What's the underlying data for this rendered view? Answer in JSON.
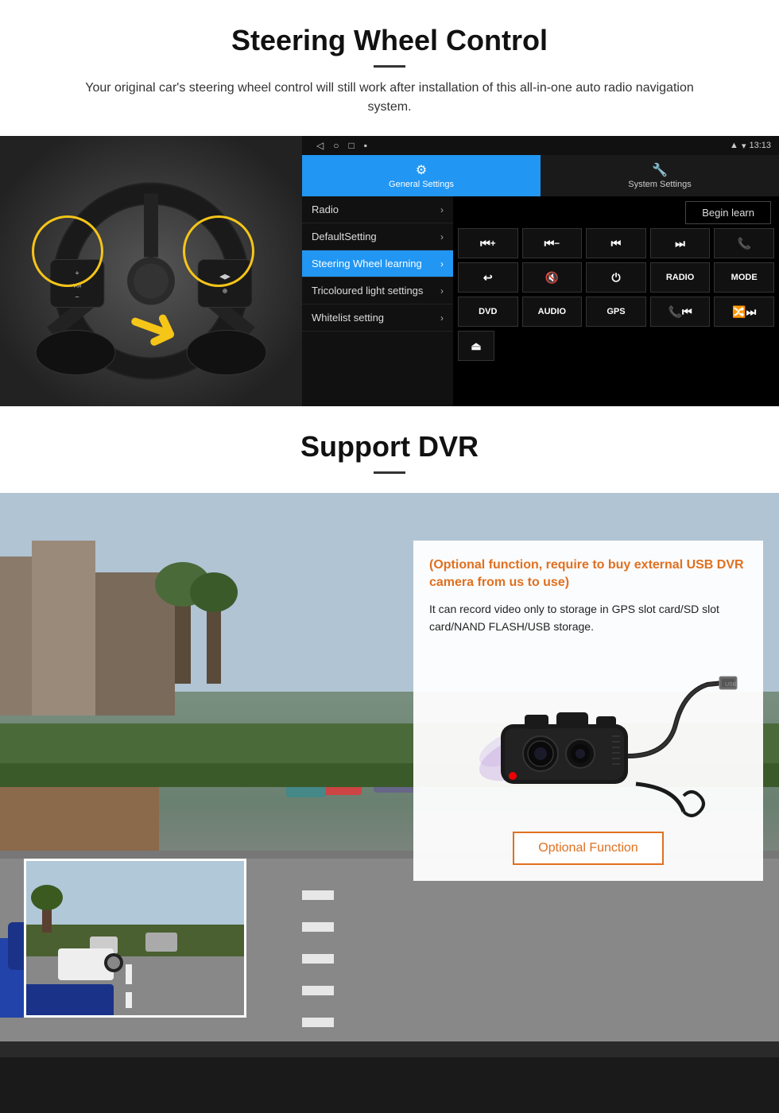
{
  "page": {
    "section1": {
      "title": "Steering Wheel Control",
      "subtitle": "Your original car's steering wheel control will still work after installation of this all-in-one auto radio navigation system.",
      "android": {
        "statusbar": {
          "time": "13:13",
          "nav_icons": [
            "◁",
            "○",
            "□",
            "▪"
          ]
        },
        "tabs": [
          {
            "label": "General Settings",
            "active": true
          },
          {
            "label": "System Settings",
            "active": false
          }
        ],
        "menu_items": [
          {
            "label": "Radio",
            "active": false
          },
          {
            "label": "DefaultSetting",
            "active": false
          },
          {
            "label": "Steering Wheel learning",
            "active": true
          },
          {
            "label": "Tricoloured light settings",
            "active": false
          },
          {
            "label": "Whitelist setting",
            "active": false
          }
        ],
        "begin_learn": "Begin learn",
        "ctrl_rows": [
          [
            "⏮+",
            "⏮—",
            "⏮⏮",
            "⏭⏭",
            "📞"
          ],
          [
            "↩",
            "🔇",
            "⏻",
            "RADIO",
            "MODE"
          ],
          [
            "DVD",
            "AUDIO",
            "GPS",
            "📞⏮",
            "🔀⏭"
          ],
          [
            "⏏"
          ]
        ]
      }
    },
    "section2": {
      "title": "Support DVR",
      "card": {
        "highlight_text": "(Optional function, require to buy external USB DVR camera from us to use)",
        "body_text": "It can record video only to storage in GPS slot card/SD slot card/NAND FLASH/USB storage.",
        "optional_button_label": "Optional Function"
      }
    }
  }
}
